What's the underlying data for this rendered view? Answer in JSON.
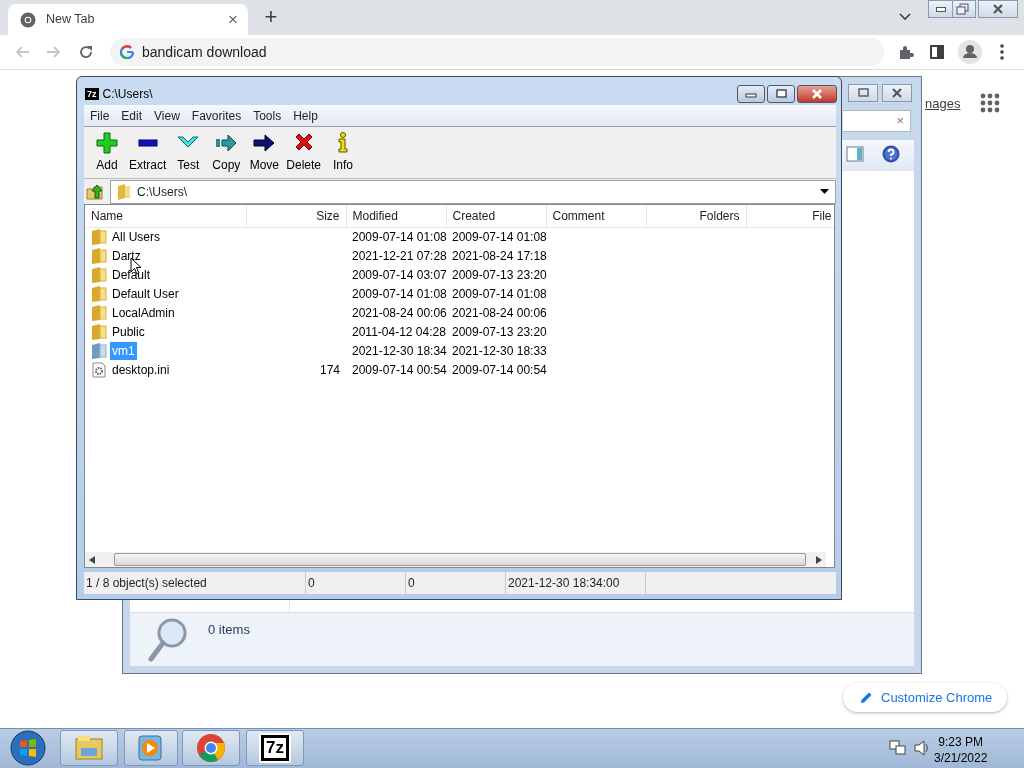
{
  "browser": {
    "tab": {
      "title": "New Tab",
      "close": "×"
    },
    "new_tab": "+",
    "address": "bandicam download",
    "images_link": "nages",
    "customize_button": "Customize Chrome"
  },
  "background_window": {
    "search_clear": "×",
    "status": "0 items"
  },
  "sevenzip": {
    "icon_text": "7z",
    "title": "C:\\Users\\",
    "menu": [
      "File",
      "Edit",
      "View",
      "Favorites",
      "Tools",
      "Help"
    ],
    "toolbar": [
      {
        "label": "Add",
        "kind": "add"
      },
      {
        "label": "Extract",
        "kind": "extract"
      },
      {
        "label": "Test",
        "kind": "test"
      },
      {
        "label": "Copy",
        "kind": "copy"
      },
      {
        "label": "Move",
        "kind": "move"
      },
      {
        "label": "Delete",
        "kind": "delete"
      },
      {
        "label": "Info",
        "kind": "info"
      }
    ],
    "path": "C:\\Users\\",
    "columns": [
      "Name",
      "Size",
      "Modified",
      "Created",
      "Comment",
      "Folders",
      "File"
    ],
    "rows": [
      {
        "name": "All Users",
        "kind": "folder",
        "size": "",
        "modified": "2009-07-14 01:08",
        "created": "2009-07-14 01:08",
        "selected": false
      },
      {
        "name": "Dartz",
        "kind": "folder",
        "size": "",
        "modified": "2021-12-21 07:28",
        "created": "2021-08-24 17:18",
        "selected": false
      },
      {
        "name": "Default",
        "kind": "folder",
        "size": "",
        "modified": "2009-07-14 03:07",
        "created": "2009-07-13 23:20",
        "selected": false
      },
      {
        "name": "Default User",
        "kind": "folder",
        "size": "",
        "modified": "2009-07-14 01:08",
        "created": "2009-07-14 01:08",
        "selected": false
      },
      {
        "name": "LocalAdmin",
        "kind": "folder",
        "size": "",
        "modified": "2021-08-24 00:06",
        "created": "2021-08-24 00:06",
        "selected": false
      },
      {
        "name": "Public",
        "kind": "folder",
        "size": "",
        "modified": "2011-04-12 04:28",
        "created": "2009-07-13 23:20",
        "selected": false
      },
      {
        "name": "vm1",
        "kind": "special-folder",
        "size": "",
        "modified": "2021-12-30 18:34",
        "created": "2021-12-30 18:33",
        "selected": true
      },
      {
        "name": "desktop.ini",
        "kind": "settings-file",
        "size": "174",
        "modified": "2009-07-14 00:54",
        "created": "2009-07-14 00:54",
        "selected": false
      }
    ],
    "status": [
      "1 / 8 object(s) selected",
      "0",
      "0",
      "2021-12-30 18:34:00"
    ]
  },
  "taskbar": {
    "apps": [
      {
        "kind": "explorer"
      },
      {
        "kind": "media"
      },
      {
        "kind": "chrome"
      },
      {
        "kind": "sevenzip",
        "label": "7z"
      }
    ],
    "time": "9:23 PM",
    "date": "3/21/2022"
  }
}
